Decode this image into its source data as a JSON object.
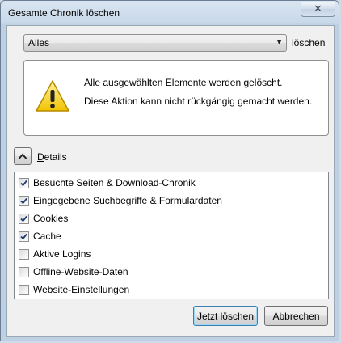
{
  "window": {
    "title": "Gesamte Chronik löschen",
    "close_glyph": "✕"
  },
  "range": {
    "selected": "Alles",
    "arrow_glyph": "▼",
    "label": "löschen"
  },
  "warning": {
    "icon": "warning-triangle-icon",
    "line1": "Alle ausgewählten Elemente werden gelöscht.",
    "line2": "Diese Aktion kann nicht rückgängig gemacht werden."
  },
  "details": {
    "label_first": "D",
    "label_rest": "etails",
    "expanded": true
  },
  "items": [
    {
      "label": "Besuchte Seiten & Download-Chronik",
      "checked": true
    },
    {
      "label": "Eingegebene Suchbegriffe & Formulardaten",
      "checked": true
    },
    {
      "label": "Cookies",
      "checked": true
    },
    {
      "label": "Cache",
      "checked": true
    },
    {
      "label": "Aktive Logins",
      "checked": false
    },
    {
      "label": "Offline-Website-Daten",
      "checked": false
    },
    {
      "label": "Website-Einstellungen",
      "checked": false
    }
  ],
  "buttons": {
    "clear_now": "Jetzt löschen",
    "cancel": "Abbrechen"
  }
}
